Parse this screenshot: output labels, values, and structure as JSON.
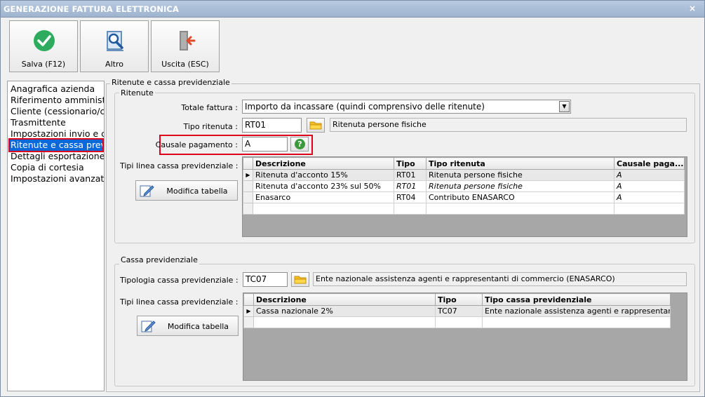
{
  "window": {
    "title": "GENERAZIONE FATTURA ELETTRONICA",
    "close_glyph": "×"
  },
  "toolbar": {
    "save_label": "Salva (F12)",
    "altro_label": "Altro",
    "exit_label": "Uscita (ESC)"
  },
  "sidebar": {
    "items": [
      {
        "label": "Anagrafica azienda"
      },
      {
        "label": "Riferimento amministrativo"
      },
      {
        "label": "Cliente (cessionario/committente)"
      },
      {
        "label": "Trasmittente"
      },
      {
        "label": "Impostazioni invio e conservazione"
      },
      {
        "label": "Ritenute e cassa previdenziale"
      },
      {
        "label": "Dettagli esportazione"
      },
      {
        "label": "Copia di cortesia"
      },
      {
        "label": "Impostazioni avanzate"
      }
    ],
    "selected_index": 5
  },
  "main": {
    "group_title": "Ritenute e cassa previdenziale",
    "ritenute": {
      "title": "Ritenute",
      "totale_fattura_label": "Totale fattura :",
      "totale_fattura_value": "Importo da incassare (quindi comprensivo delle ritenute)",
      "tipo_ritenuta_label": "Tipo ritenuta :",
      "tipo_ritenuta_code": "RT01",
      "tipo_ritenuta_desc": "Ritenuta persone fisiche",
      "causale_label": "Causale pagamento :",
      "causale_value": "A",
      "help_glyph": "?",
      "tipi_linea_label": "Tipi linea cassa previdenziale :",
      "modifica_label": "Modifica tabella",
      "columns": [
        "Descrizione",
        "Tipo",
        "Tipo ritenuta",
        "Causale paga..."
      ],
      "rows": [
        {
          "descrizione": "Ritenuta d'acconto 15%",
          "tipo": "RT01",
          "tipo_ritenuta": "Ritenuta persone fisiche",
          "causale": "A"
        },
        {
          "descrizione": "Ritenuta d'acconto 23% sul 50%",
          "tipo": "RT01",
          "tipo_ritenuta": "Ritenuta persone fisiche",
          "causale": "A"
        },
        {
          "descrizione": "Enasarco",
          "tipo": "RT04",
          "tipo_ritenuta": "Contributo ENASARCO",
          "causale": "A"
        }
      ]
    },
    "cassa": {
      "title": "Cassa previdenziale",
      "tipologia_label": "Tipologia cassa previdenziale :",
      "tipologia_code": "TC07",
      "tipologia_desc": "Ente nazionale assistenza agenti e rappresentanti di commercio (ENASARCO)",
      "tipi_linea_label": "Tipi linea cassa previdenziale :",
      "modifica_label": "Modifica tabella",
      "columns": [
        "Descrizione",
        "Tipo",
        "Tipo cassa previdenziale"
      ],
      "rows": [
        {
          "descrizione": "Cassa nazionale 2%",
          "tipo": "TC07",
          "tipo_cassa": "Ente nazionale assistenza agenti e rappresentanti d..."
        }
      ]
    }
  },
  "colors": {
    "accent": "#0a68d8",
    "highlight_border": "#e0001b"
  }
}
